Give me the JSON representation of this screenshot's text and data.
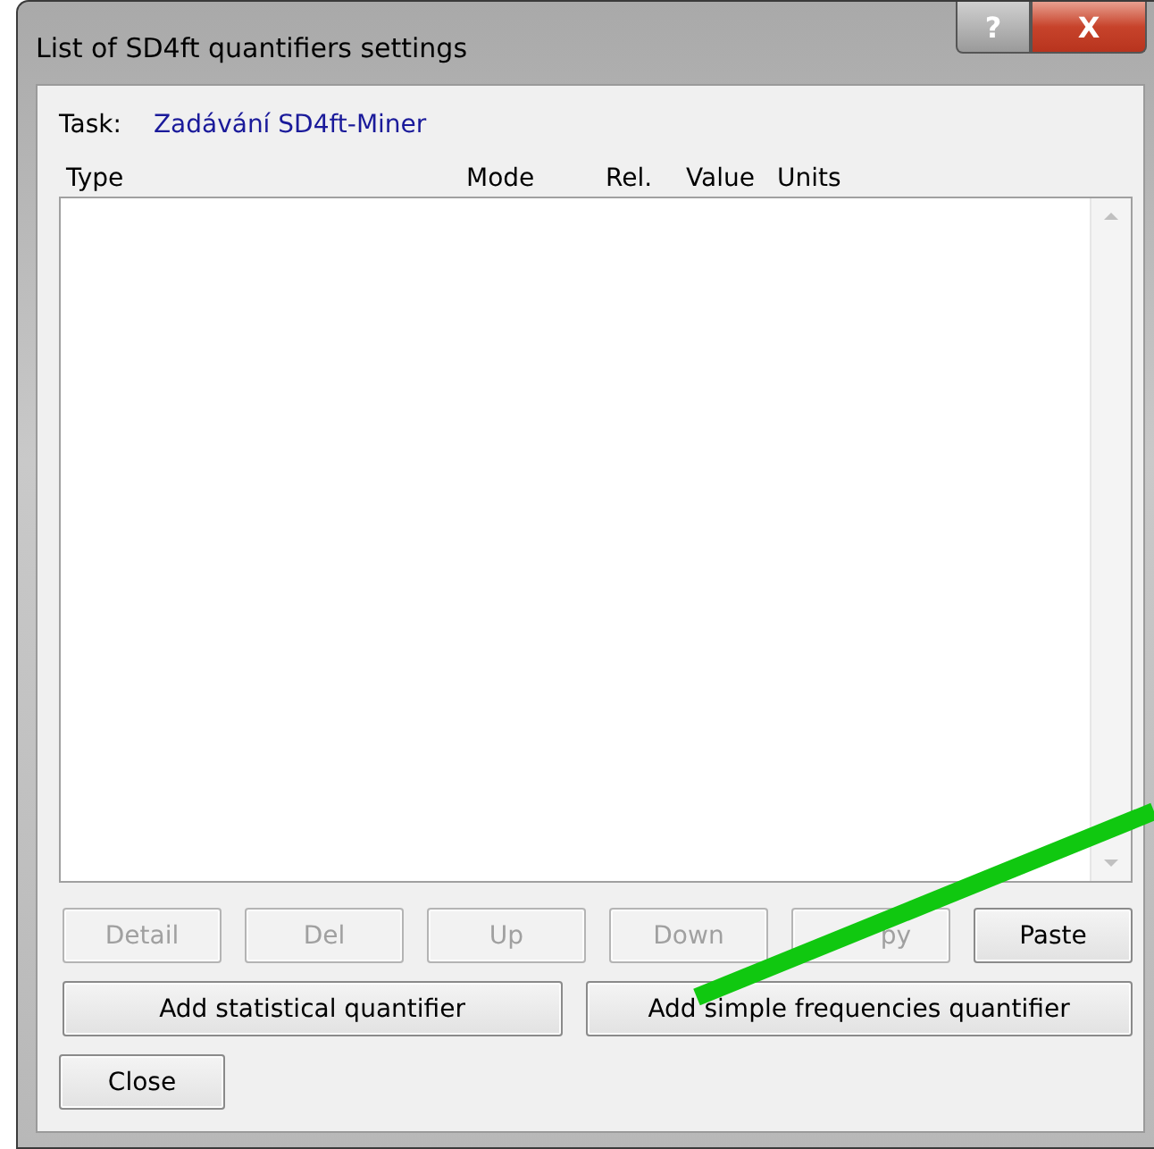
{
  "window": {
    "title": "List of SD4ft quantifiers settings",
    "buttons": [
      {
        "kind": "help",
        "label": "?"
      },
      {
        "kind": "close",
        "label": "X"
      }
    ]
  },
  "task": {
    "label": "Task:",
    "value": "Zadávání SD4ft-Miner"
  },
  "table": {
    "columns": [
      "Type",
      "Mode",
      "Rel.",
      "Value",
      "Units"
    ]
  },
  "action_buttons": [
    {
      "label": "Detail",
      "disabled": true
    },
    {
      "label": "Del",
      "disabled": true
    },
    {
      "label": "Up",
      "disabled": true
    },
    {
      "label": "Down",
      "disabled": true
    },
    {
      "label": "py",
      "disabled": true
    },
    {
      "label": "Paste",
      "disabled": false
    }
  ],
  "add_buttons": [
    {
      "label": "Add statistical quantifier",
      "disabled": false
    },
    {
      "label": "Add simple frequencies quantifier",
      "disabled": false
    }
  ],
  "close_button": {
    "label": "Close",
    "disabled": false
  }
}
